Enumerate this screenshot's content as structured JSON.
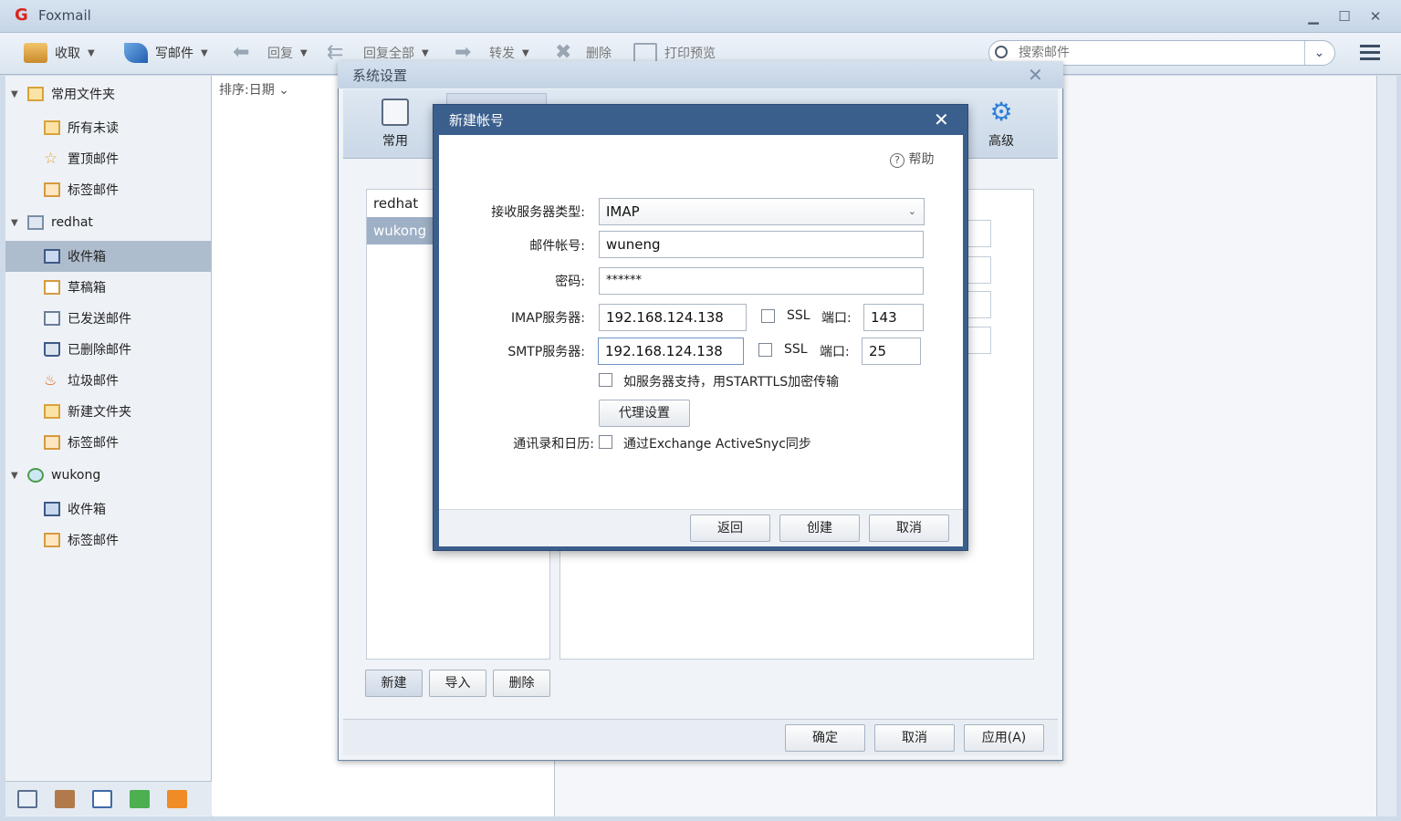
{
  "app": {
    "title": "Foxmail",
    "logo": "G"
  },
  "window_controls": {
    "minimize": "▁",
    "maximize": "☐",
    "close": "✕"
  },
  "toolbar": {
    "receive": "收取",
    "compose": "写邮件",
    "reply": "回复",
    "reply_all": "回复全部",
    "forward": "转发",
    "delete": "删除",
    "print_preview": "打印预览",
    "search_placeholder": "搜索邮件"
  },
  "sidebar": {
    "groups": [
      {
        "label": "常用文件夹",
        "items": [
          "所有未读",
          "置顶邮件",
          "标签邮件"
        ]
      },
      {
        "label": "redhat",
        "items": [
          "收件箱",
          "草稿箱",
          "已发送邮件",
          "已删除邮件",
          "垃圾邮件",
          "新建文件夹",
          "标签邮件"
        ]
      },
      {
        "label": "wukong",
        "items": [
          "收件箱",
          "标签邮件"
        ]
      }
    ]
  },
  "maillist": {
    "sort_label": "排序:日期"
  },
  "settings": {
    "title": "系统设置",
    "tabs": {
      "common": "常用",
      "advanced": "高级"
    },
    "accounts": [
      "redhat",
      "wukong"
    ],
    "buttons": {
      "new": "新建",
      "import": "导入",
      "delete": "删除",
      "ok": "确定",
      "cancel": "取消",
      "apply": "应用(A)"
    }
  },
  "new_account": {
    "title": "新建帐号",
    "help": "帮助",
    "labels": {
      "server_type": "接收服务器类型:",
      "account": "邮件帐号:",
      "password": "密码:",
      "imap_server": "IMAP服务器:",
      "smtp_server": "SMTP服务器:",
      "ssl": "SSL",
      "port": "端口:",
      "starttls": "如服务器支持，用STARTTLS加密传输",
      "proxy": "代理设置",
      "contacts": "通讯录和日历:",
      "exchange": "通过Exchange ActiveSnyc同步"
    },
    "values": {
      "server_type": "IMAP",
      "account": "wuneng",
      "password": "******",
      "imap_server": "192.168.124.138",
      "imap_port": "143",
      "smtp_server": "192.168.124.138",
      "smtp_port": "25"
    },
    "buttons": {
      "back": "返回",
      "create": "创建",
      "cancel": "取消"
    }
  }
}
